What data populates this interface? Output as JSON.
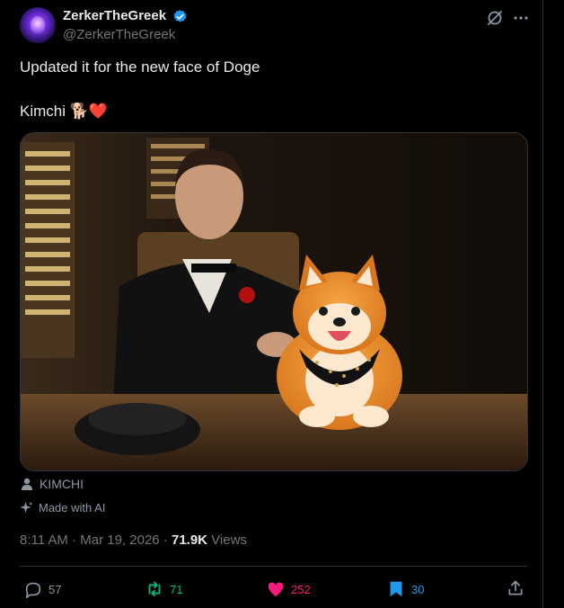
{
  "author": {
    "display_name": "ZerkerTheGreek",
    "handle": "@ZerkerTheGreek",
    "verified": true,
    "verified_color": "#1d9bf0"
  },
  "post": {
    "line1": "Updated it for the new face of Doge",
    "line2": "Kimchi 🐕❤️",
    "media_tag": "KIMCHI",
    "made_with_ai": "Made with AI",
    "timestamp": "8:11 AM · Mar 19, 2026 · ",
    "views_count": "71.9K",
    "views_label": " Views"
  },
  "actions": {
    "replies": "57",
    "reposts": "71",
    "likes": "252",
    "bookmarks": "30"
  },
  "colors": {
    "background": "#000000",
    "repost": "#00ba7c",
    "like": "#f91880",
    "bookmark": "#1d9bf0",
    "muted": "#71767b"
  },
  "icons": [
    "verified-badge-icon",
    "grok-icon",
    "more-icon",
    "person-tag-icon",
    "sparkle-icon",
    "reply-icon",
    "repost-icon",
    "heart-icon",
    "bookmark-icon",
    "share-icon"
  ]
}
